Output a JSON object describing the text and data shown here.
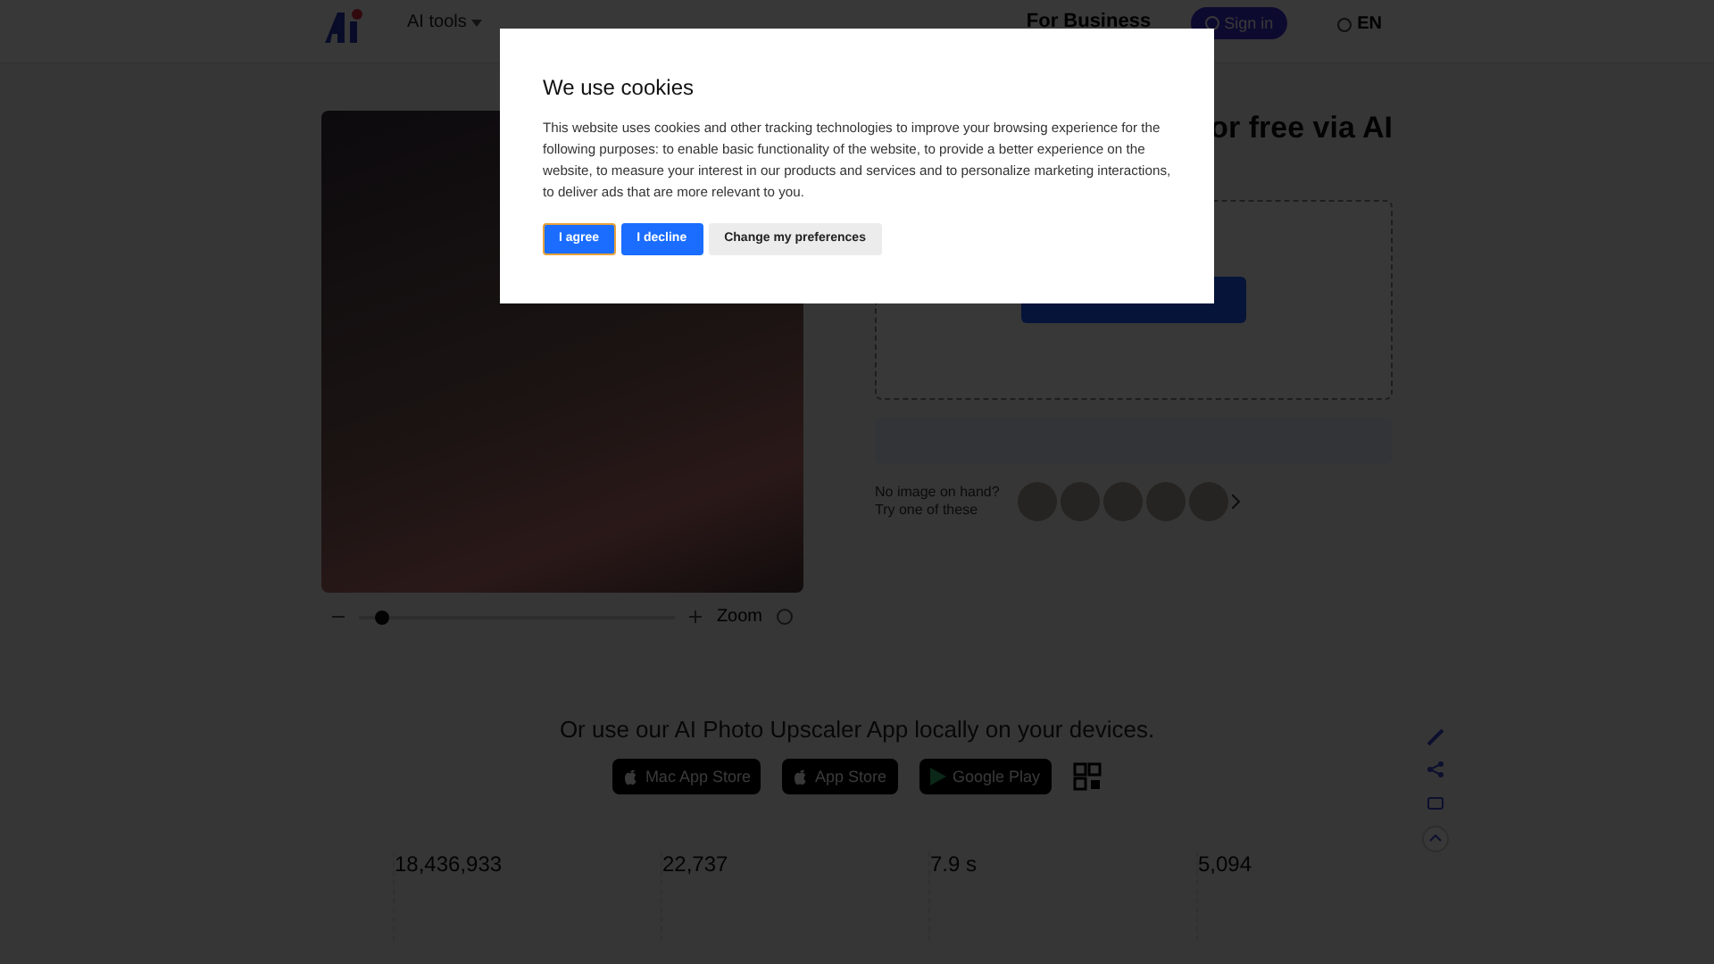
{
  "nav": {
    "items": [
      {
        "label": "AI tools",
        "caret": true
      }
    ],
    "business": "For Business",
    "sign_in": "Sign in",
    "language": "EN"
  },
  "hero": {
    "title_fragment": "or free via AI",
    "samples_prompt": [
      "No image on hand?",
      "Try one of these"
    ]
  },
  "preview": {
    "zoom_label": "Zoom",
    "zoom": {
      "level": 0.05
    }
  },
  "apps": {
    "title": "Or use our AI Photo Upscaler App locally on your devices.",
    "badges": [
      {
        "kind": "apple",
        "big": "Mac App Store"
      },
      {
        "kind": "apple",
        "big": "App Store"
      },
      {
        "kind": "play",
        "big": "Google Play"
      }
    ]
  },
  "stats": [
    {
      "value": "18,436,933"
    },
    {
      "value": "22,737"
    },
    {
      "value": "7.9 s"
    },
    {
      "value": "5,094"
    }
  ],
  "cookie_dialog": {
    "title": "We use cookies",
    "body": "This website uses cookies and other tracking technologies to improve your browsing experience for the following purposes: to enable basic functionality of the website, to provide a better experience on the website, to measure your interest in our products and services and to personalize marketing interactions, to deliver ads that are more relevant to you.",
    "buttons": [
      {
        "label": "I agree",
        "kind": "primary",
        "focused": true
      },
      {
        "label": "I decline",
        "kind": "primary",
        "focused": false
      },
      {
        "label": "Change my preferences",
        "kind": "secondary",
        "focused": false
      }
    ]
  }
}
